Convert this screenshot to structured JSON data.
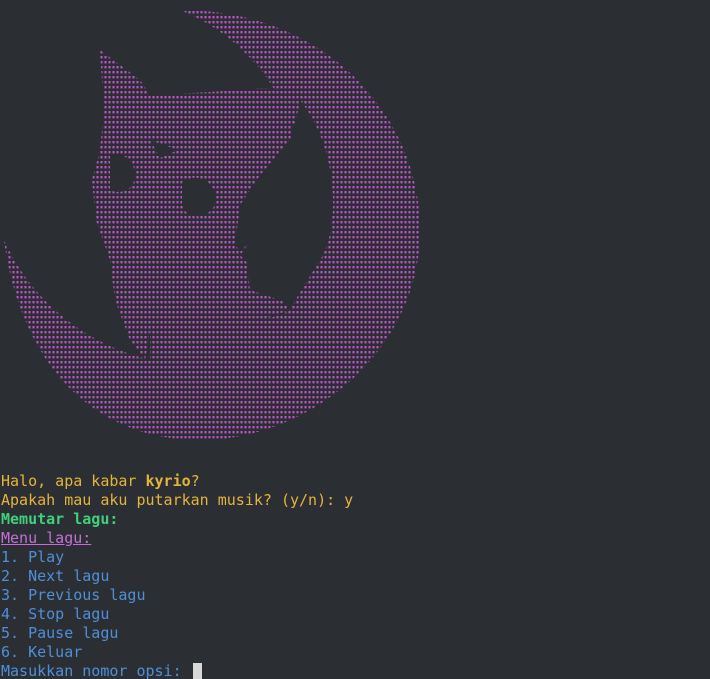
{
  "colors": {
    "background": "#2b2f33",
    "art": "#c056cc",
    "greeting": "#e5b43b",
    "playing": "#3fd07a",
    "menu_header": "#c56ed6",
    "menu_items": "#4f8fd8"
  },
  "art": {
    "icon": "cat-crescent-moon-ascii-art"
  },
  "greeting": {
    "prefix": "Halo, apa kabar ",
    "name": "kyrio",
    "suffix": "?"
  },
  "prompt": {
    "question": "Apakah mau aku putarkan musik? (y/n): ",
    "answer": "y"
  },
  "status": "Memutar lagu:",
  "menu": {
    "header": "Menu lagu:",
    "items": [
      "1. Play",
      "2. Next lagu",
      "3. Previous lagu",
      "4. Stop lagu",
      "5. Pause lagu",
      "6. Keluar"
    ]
  },
  "input_prompt": "Masukkan nomor opsi: "
}
